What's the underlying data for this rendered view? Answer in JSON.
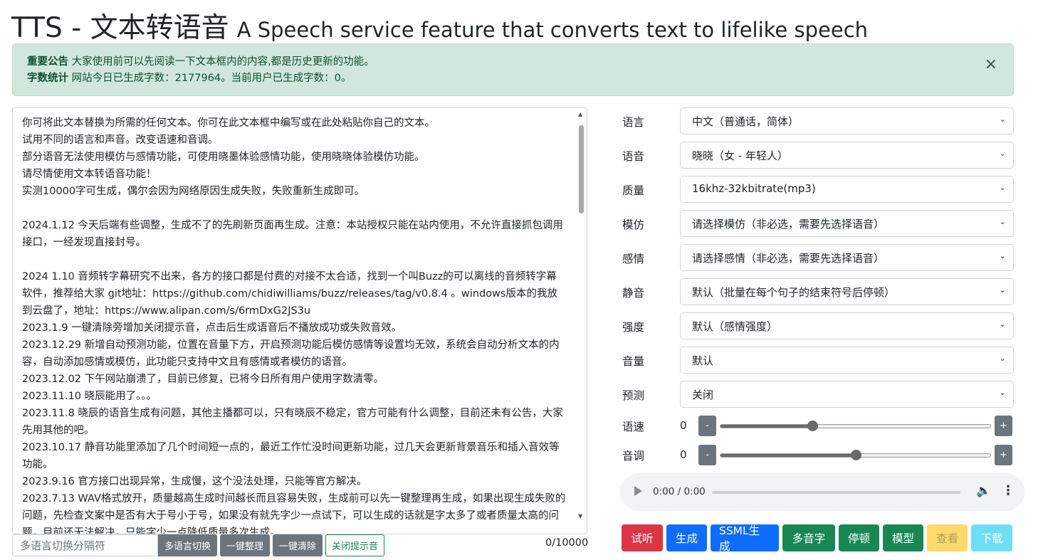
{
  "header": {
    "title": "TTS - 文本转语音",
    "subtitle": "A Speech service feature that converts text to lifelike speech"
  },
  "alert": {
    "notice_label": "重要公告",
    "notice_text": "大家使用前可以先阅读一下文本框内的内容,都是历史更新的功能。",
    "stats_label": "字数统计",
    "stats_text": "网站今日已生成字数：2177964。当前用户已生成字数：0。",
    "close": "×"
  },
  "editor": {
    "text": "你可将此文本替换为所需的任何文本。你可在此文本框中编写或在此处粘贴你自己的文本。\n试用不同的语言和声音。改变语速和音调。\n部分语音无法使用模仿与感情功能，可使用晓墨体验感情功能，使用晓晓体验模仿功能。\n请尽情使用文本转语音功能！\n实测10000字可生成，偶尔会因为网络原因生成失败，失败重新生成即可。\n\n2024.1.12 今天后端有些调整，生成不了的先刷新页面再生成。注意：本站授权只能在站内使用，不允许直接抓包调用接口，一经发现直接封号。\n\n2024 1.10 音频转字幕研究不出来，各方的接口都是付费的对接不太合适，找到一个叫Buzz的可以离线的音频转字幕软件，推荐给大家 git地址：https://github.com/chidiwilliams/buzz/releases/tag/v0.8.4 。windows版本的我放到云盘了，地址：https://www.alipan.com/s/6rmDxG2JS3u\n2023.1.9 一键清除旁增加关闭提示音，点击后生成语音后不播放成功或失败音效。\n2023.12.29 新增自动预测功能，位置在音量下方，开启预测功能后模仿感情等设置均无效，系统会自动分析文本的内容，自动添加感情或模仿，此功能只支持中文且有感情或者模仿的语音。\n2023.12.02 下午网站崩溃了，目前已修复，已将今日所有用户使用字数清零。\n2023.11.10 晓辰能用了。。。\n2023.11.8 晓辰的语音生成有问题，其他主播都可以，只有晓辰不稳定，官方可能有什么调整，目前还未有公告，大家先用其他的吧。\n2023.10.17 静音功能里添加了几个时间短一点的，最近工作忙没时间更新功能，过几天会更新背景音乐和插入音效等功能。\n2023.9.16 官方接口出现异常，生成慢，这个没法处理，只能等官方解决。\n2023.7.13 WAV格式放开，质量越高生成时间越长而且容易失败，生成前可以先一键整理再生成，如果出现生成失败的问题，先检查文案中是否有大于号小于号，如果没有就先字少一点试下，可以生成的话就是字太多了或者质量太高的问题，目前还无法解决，只能字少一点降低质量多次生成。"
  },
  "bottom_bar": {
    "separator_placeholder": "多语言切换分隔符",
    "multi_lang_switch": "多语言切换",
    "one_click_tidy": "一键整理",
    "one_click_clear": "一键清除",
    "close_sound": "关闭提示音",
    "counter": "0/10000"
  },
  "settings": {
    "language": {
      "label": "语言",
      "value": "中文（普通话，简体）"
    },
    "voice": {
      "label": "语音",
      "value": "晓晓（女 - 年轻人）"
    },
    "quality": {
      "label": "质量",
      "value": "16khz-32kbitrate(mp3)"
    },
    "imitate": {
      "label": "模仿",
      "value": "请选择模仿（非必选，需要先选择语音）"
    },
    "emotion": {
      "label": "感情",
      "value": "请选择感情（非必选，需要先选择语音）"
    },
    "silence": {
      "label": "静音",
      "value": "默认（批量在每个句子的结束符号后停顿）"
    },
    "intensity": {
      "label": "强度",
      "value": "默认（感情强度）"
    },
    "volume": {
      "label": "音量",
      "value": "默认"
    },
    "predict": {
      "label": "预测",
      "value": "关闭"
    },
    "speed": {
      "label": "语速",
      "value": "0",
      "minus": "-",
      "plus": "+",
      "level": 0.34
    },
    "pitch": {
      "label": "音调",
      "value": "0",
      "minus": "-",
      "plus": "+",
      "level": 0.5
    }
  },
  "audio": {
    "time": "0:00 / 0:00"
  },
  "actions": {
    "listen": "试听",
    "generate": "生成",
    "ssml_generate": "SSML生成",
    "polyphone": "多音字",
    "pause": "停顿",
    "model": "模型",
    "view": "查看",
    "download": "下载"
  },
  "colors": {
    "alert_bg": "#d1e7dd",
    "red": "#dc3545",
    "blue": "#0d6efd",
    "green": "#198754",
    "yellow": "#ffc107",
    "cyan": "#0dcaf0",
    "grey": "#6c757d"
  }
}
